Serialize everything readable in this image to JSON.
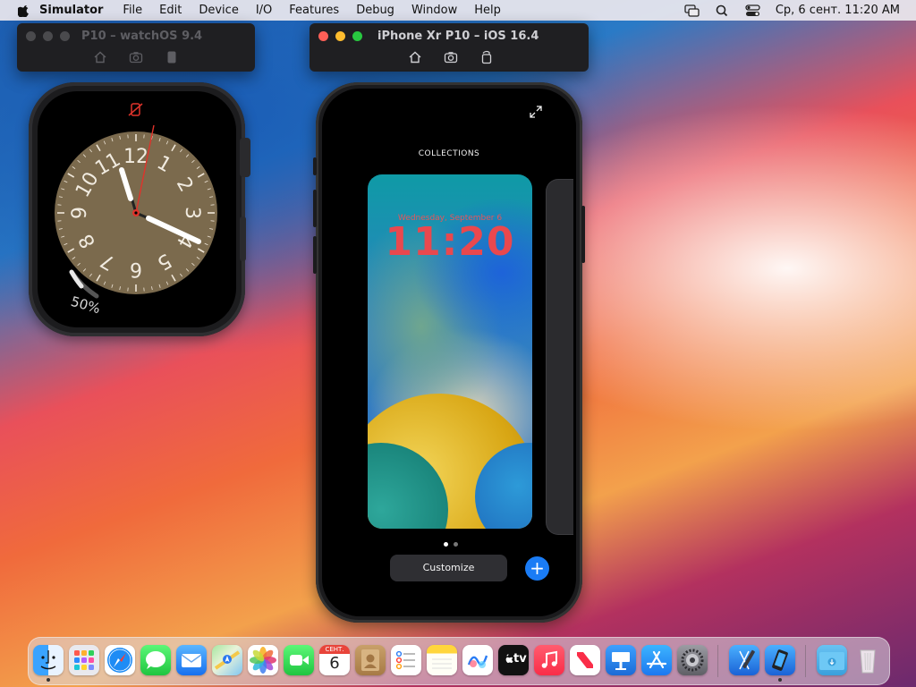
{
  "menubar": {
    "app_name": "Simulator",
    "menus": [
      "File",
      "Edit",
      "Device",
      "I/O",
      "Features",
      "Debug",
      "Window",
      "Help"
    ],
    "clock": "Ср, 6 сент.  11:20 AM",
    "status_icons": [
      "screen-mirroring-icon",
      "search-icon",
      "control-center-icon"
    ]
  },
  "watch_window": {
    "title": "P10 – watchOS 9.4",
    "toolbar": [
      "home-icon",
      "screenshot-icon",
      "rotate-icon"
    ]
  },
  "phone_window": {
    "title": "iPhone Xr P10 – iOS 16.4",
    "toolbar": [
      "home-icon",
      "screenshot-icon",
      "rotate-icon"
    ]
  },
  "watch_face": {
    "numerals": [
      "12",
      "1",
      "2",
      "3",
      "4",
      "5",
      "6",
      "7",
      "8",
      "9",
      "10",
      "11"
    ],
    "time": "11:20",
    "battery_label": "50%",
    "battery_level": 0.5,
    "status_icon": "charging-off-icon",
    "face_color": "#7b6a4d",
    "accent_color": "#e0332b"
  },
  "phone_screen": {
    "section_title": "COLLECTIONS",
    "lockscreen_date": "Wednesday, September 6",
    "lockscreen_time": "11:20",
    "pages": 2,
    "current_page": 1,
    "customize_label": "Customize",
    "add_label": "+",
    "accent_color": "#1a7cf5"
  },
  "calendar_icon": {
    "month": "СЕНТ.",
    "day": "6"
  },
  "dock": {
    "apps": [
      "finder",
      "launchpad",
      "safari",
      "messages",
      "mail",
      "maps",
      "photos",
      "facetime",
      "calendar",
      "contacts",
      "reminders",
      "notes",
      "freeform",
      "tv",
      "music",
      "news",
      "keynote",
      "app-store",
      "system-settings",
      "xcode",
      "simulator",
      "downloads",
      "trash"
    ],
    "tv_label": "tv"
  }
}
